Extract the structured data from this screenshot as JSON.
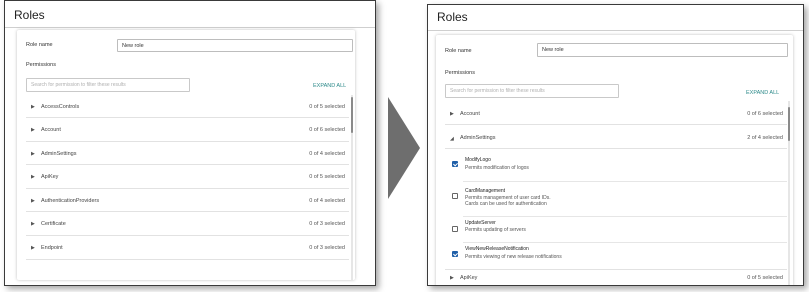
{
  "left": {
    "title": "Roles",
    "role_name_label": "Role name",
    "role_name_value": "New role",
    "permissions_label": "Permissions",
    "search_placeholder": "Search for permission to filter these results",
    "expand_all": "EXPAND ALL",
    "rows": [
      {
        "name": "AccessControls",
        "count": "0 of 5 selected"
      },
      {
        "name": "Account",
        "count": "0 of 6 selected"
      },
      {
        "name": "AdminSettings",
        "count": "0 of 4 selected"
      },
      {
        "name": "ApiKey",
        "count": "0 of 5 selected"
      },
      {
        "name": "AuthenticationProviders",
        "count": "0 of 4 selected"
      },
      {
        "name": "Certificate",
        "count": "0 of 3 selected"
      },
      {
        "name": "Endpoint",
        "count": "0 of 3 selected"
      }
    ]
  },
  "right": {
    "title": "Roles",
    "role_name_label": "Role name",
    "role_name_value": "New role",
    "permissions_label": "Permissions",
    "search_placeholder": "Search for permission to filter these results",
    "expand_all": "EXPAND ALL",
    "account": {
      "name": "Account",
      "count": "0 of 6 selected"
    },
    "admin": {
      "name": "AdminSettings",
      "count": "2 of 4 selected"
    },
    "perms": [
      {
        "name": "ModifyLogo",
        "desc": [
          "Permits modification of logos"
        ],
        "checked": true
      },
      {
        "name": "CardManagement",
        "desc": [
          "Permits management of user card IDs.",
          "Cards can be used for authentication"
        ],
        "checked": false
      },
      {
        "name": "UpdateServer",
        "desc": [
          "Permits updating of servers"
        ],
        "checked": false
      },
      {
        "name": "ViewNewReleaseNotification",
        "desc": [
          "Permits viewing of new release notifications"
        ],
        "checked": true
      }
    ],
    "apikey": {
      "name": "ApiKey",
      "count": "0 of 5 selected"
    }
  },
  "colors": {
    "accent": "#2e8b8b",
    "checkbox": "#1f5fa8",
    "arrow": "#6e6e6e"
  },
  "icons": {
    "collapsed": "▶",
    "expanded": "◢"
  }
}
